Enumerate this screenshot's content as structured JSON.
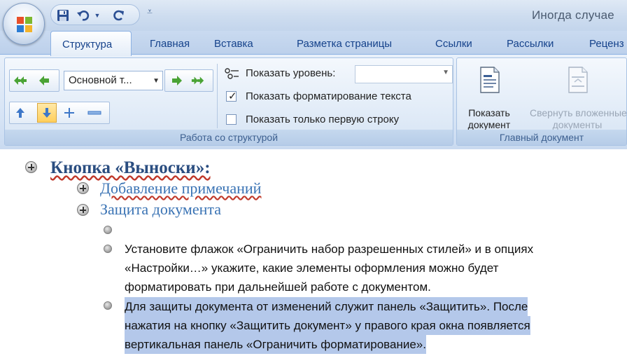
{
  "window": {
    "title": "Иногда случае"
  },
  "colors": {
    "ribbon_text": "#15428b",
    "heading1": "#2a4d80",
    "heading2": "#3a73b4",
    "selection": "#b4c8ea",
    "highlight": "#ffcf5b"
  },
  "quick_access": {
    "icons": [
      "save-icon",
      "undo-icon",
      "dropdown-icon",
      "redo-icon",
      "customize-icon"
    ]
  },
  "tabs": [
    {
      "label": "Структура",
      "active": true
    },
    {
      "label": "Главная"
    },
    {
      "label": "Вставка"
    },
    {
      "label": "Разметка страницы"
    },
    {
      "label": "Ссылки"
    },
    {
      "label": "Рассылки"
    },
    {
      "label": "Реценз"
    }
  ],
  "outline_group": {
    "caption": "Работа со структурой",
    "level_combo_value": "Основной т...",
    "show_level_label": "Показать уровень:",
    "show_formatting": {
      "label": "Показать форматирование текста",
      "checked": true
    },
    "show_first_line": {
      "label": "Показать только первую строку",
      "checked": false
    }
  },
  "master_group": {
    "caption": "Главный документ",
    "show_document": {
      "line1": "Показать",
      "line2": "документ"
    },
    "collapse_subdocs": {
      "line1": "Свернуть вложенные",
      "line2": "документы",
      "disabled": true
    }
  },
  "document": {
    "heading1": "Кнопка «Выноски»:",
    "heading2_items": [
      "Добавление примечаний",
      "Защита документа"
    ],
    "paragraph1_lines": [
      "Установите флажок «Ограничить набор разрешенных стилей» и в опциях",
      "«Настройки…» укажите, какие элементы оформления можно будет",
      "форматировать при дальнейшей работе с документом."
    ],
    "paragraph2_lines": [
      "Для защиты документа от изменений служит панель «Защитить». После",
      "нажатия на кнопку «Защитить документ» у правого края окна появляется",
      "вертикальная панель «Ограничить форматирование»."
    ]
  }
}
